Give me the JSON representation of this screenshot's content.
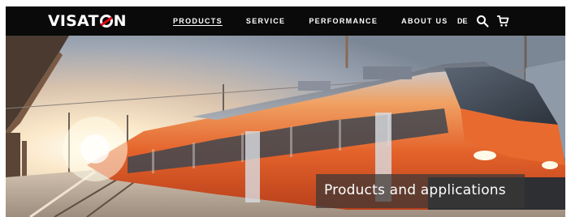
{
  "header": {
    "logo_text_left": "VISAT",
    "logo_text_right": "N",
    "nav": [
      {
        "label": "PRODUCTS",
        "active": true
      },
      {
        "label": "SERVICE",
        "active": false
      },
      {
        "label": "PERFORMANCE",
        "active": false
      },
      {
        "label": "ABOUT US",
        "active": false
      }
    ],
    "language": "DE",
    "icons": [
      "search-icon",
      "cart-icon"
    ]
  },
  "hero": {
    "caption": "Products and applications"
  },
  "colors": {
    "header_bg": "#0a0a0a",
    "brand_red": "#e30613",
    "train_orange": "#e4622a",
    "caption_bg": "#3a3836"
  }
}
